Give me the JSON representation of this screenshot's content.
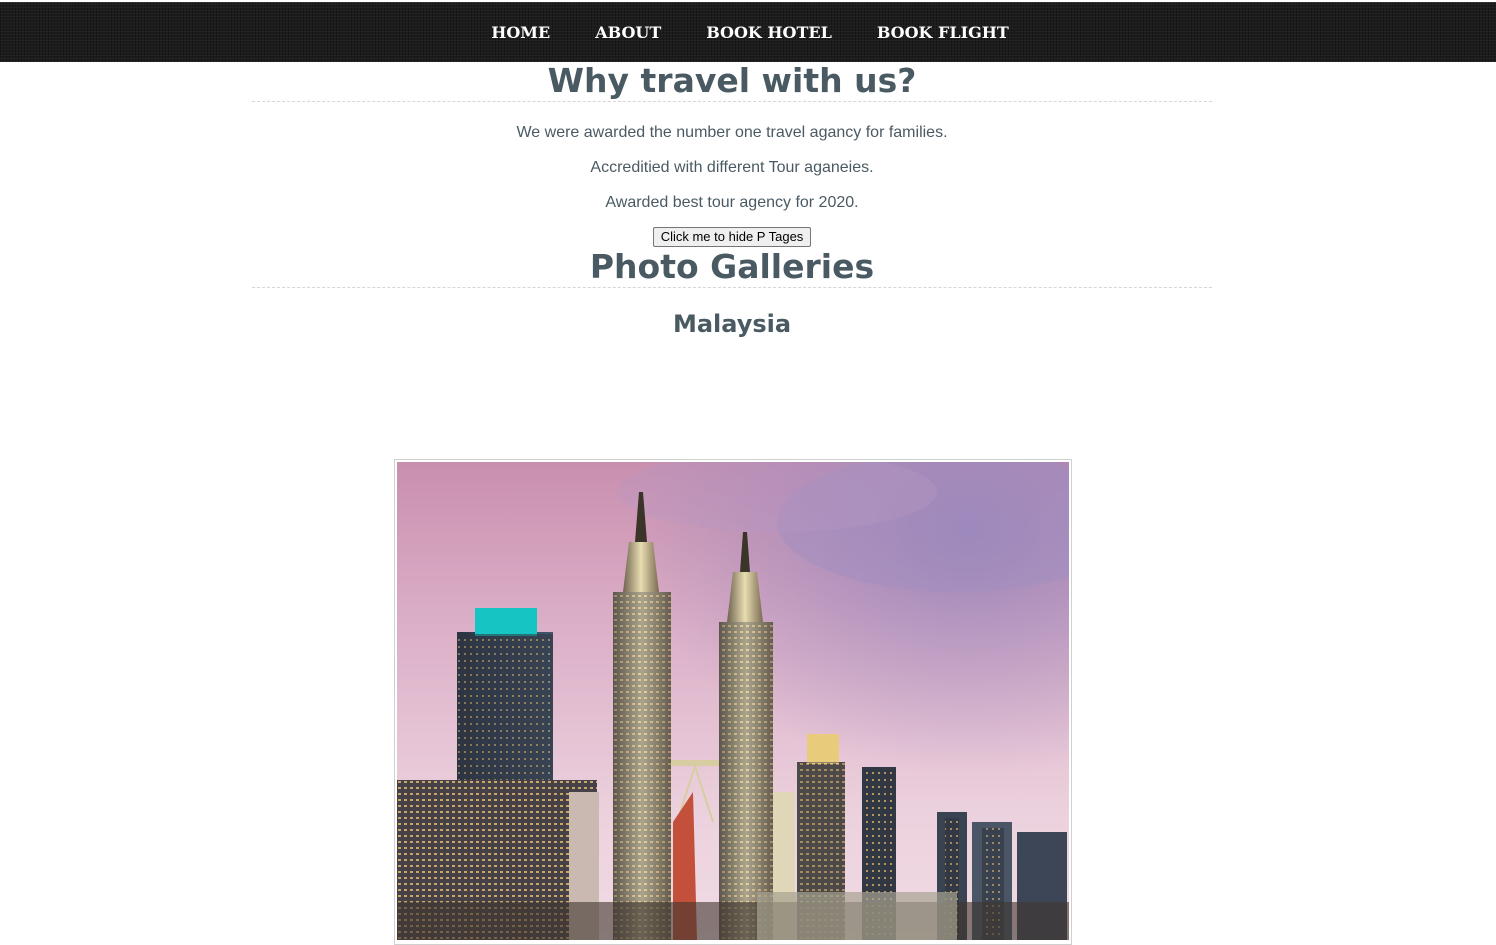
{
  "nav": {
    "items": [
      {
        "label": "HOME"
      },
      {
        "label": "ABOUT"
      },
      {
        "label": "BOOK HOTEL"
      },
      {
        "label": "BOOK FLIGHT"
      }
    ]
  },
  "why": {
    "title": "Why travel with us?",
    "lines": [
      "We were awarded the number one travel agancy for families.",
      "Accreditied with different Tour aganeies.",
      "Awarded best tour agency for 2020."
    ],
    "button_label": "Click me to hide P Tages"
  },
  "gallery": {
    "title": "Photo Galleries",
    "country": "Malaysia",
    "photo_icon": "city-skyline-photo"
  },
  "colors": {
    "navbar": "#1c1c1c",
    "heading": "#4a5a63",
    "text": "#4a5a63",
    "sky_top": "#d4a3c0",
    "sky_bottom": "#e9c6d6"
  }
}
